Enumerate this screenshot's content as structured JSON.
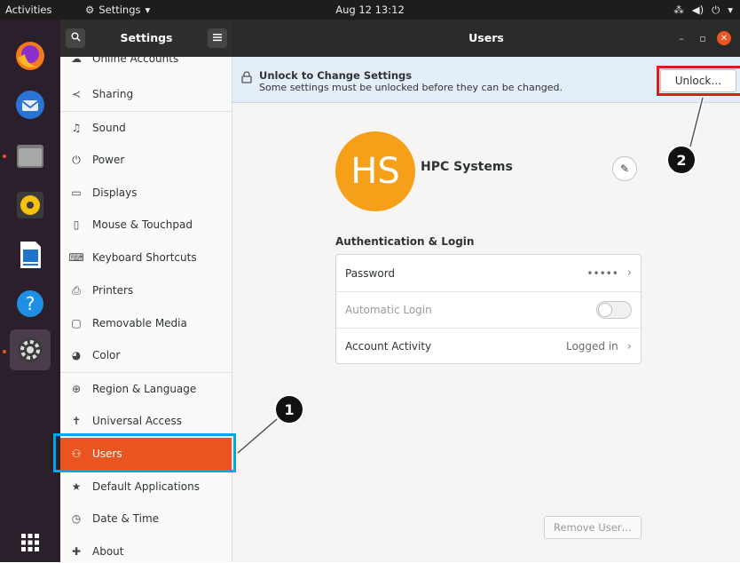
{
  "topbar": {
    "activities": "Activities",
    "app_menu": "Settings",
    "clock": "Aug 12  13:12"
  },
  "dock": {
    "apps": [
      "firefox-icon",
      "thunderbird-icon",
      "files-icon",
      "rhythmbox-icon",
      "writer-icon",
      "help-icon",
      "settings-icon",
      "app-grid-icon"
    ]
  },
  "sidebar": {
    "title": "Settings",
    "items": [
      {
        "label": "Online Accounts"
      },
      {
        "label": "Sharing"
      },
      {
        "label": "Sound"
      },
      {
        "label": "Power"
      },
      {
        "label": "Displays"
      },
      {
        "label": "Mouse & Touchpad"
      },
      {
        "label": "Keyboard Shortcuts"
      },
      {
        "label": "Printers"
      },
      {
        "label": "Removable Media"
      },
      {
        "label": "Color"
      },
      {
        "label": "Region & Language"
      },
      {
        "label": "Universal Access"
      },
      {
        "label": "Users"
      },
      {
        "label": "Default Applications"
      },
      {
        "label": "Date & Time"
      },
      {
        "label": "About"
      }
    ],
    "active": "Users"
  },
  "main": {
    "title": "Users",
    "unlock_bar": {
      "title": "Unlock to Change Settings",
      "subtitle": "Some settings must be unlocked before they can be changed.",
      "button": "Unlock…"
    },
    "user": {
      "initials": "HS",
      "name": "HPC Systems",
      "avatar_color": "#f6a01a"
    },
    "auth": {
      "heading": "Authentication & Login",
      "password_label": "Password",
      "password_value": "•••••",
      "autologin_label": "Automatic Login",
      "activity_label": "Account Activity",
      "activity_value": "Logged in"
    },
    "remove_button": "Remove User…"
  },
  "callouts": {
    "one": "1",
    "two": "2"
  },
  "colors": {
    "accent": "#e95420",
    "highlight_blue": "#00a8e8",
    "highlight_red": "#e01b1b"
  }
}
